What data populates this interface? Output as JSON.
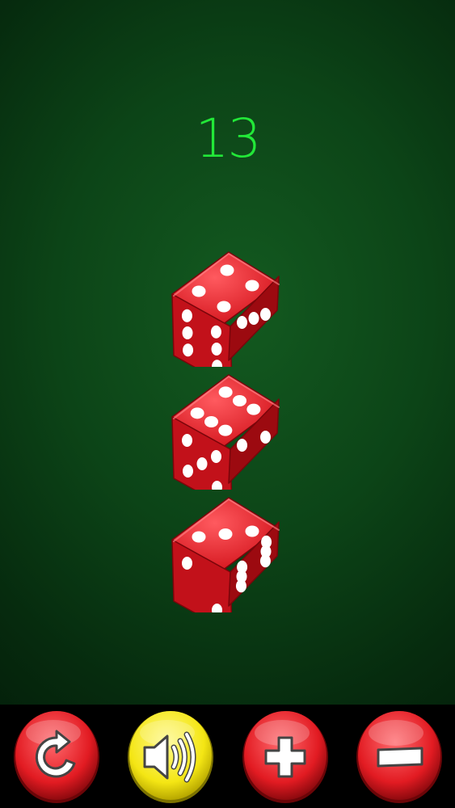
{
  "game": {
    "total": "13",
    "total_color": "#22e838",
    "table_color": "#0c4417",
    "dice": [
      {
        "name": "die-1",
        "top_face": 4,
        "left_face": 6,
        "right_face": 3,
        "color": "#d3141c"
      },
      {
        "name": "die-2",
        "top_face": 6,
        "left_face": 5,
        "right_face": 2,
        "color": "#d3141c"
      },
      {
        "name": "die-3",
        "top_face": 3,
        "left_face": 2,
        "right_face": 6,
        "color": "#d3141c"
      }
    ]
  },
  "toolbar": {
    "buttons": [
      {
        "name": "reroll-button",
        "icon": "rotate-icon",
        "color": "#e21b22"
      },
      {
        "name": "sound-button",
        "icon": "speaker-icon",
        "color": "#f4e614"
      },
      {
        "name": "add-die-button",
        "icon": "plus-icon",
        "color": "#e21b22"
      },
      {
        "name": "remove-die-button",
        "icon": "minus-icon",
        "color": "#e21b22"
      }
    ]
  }
}
